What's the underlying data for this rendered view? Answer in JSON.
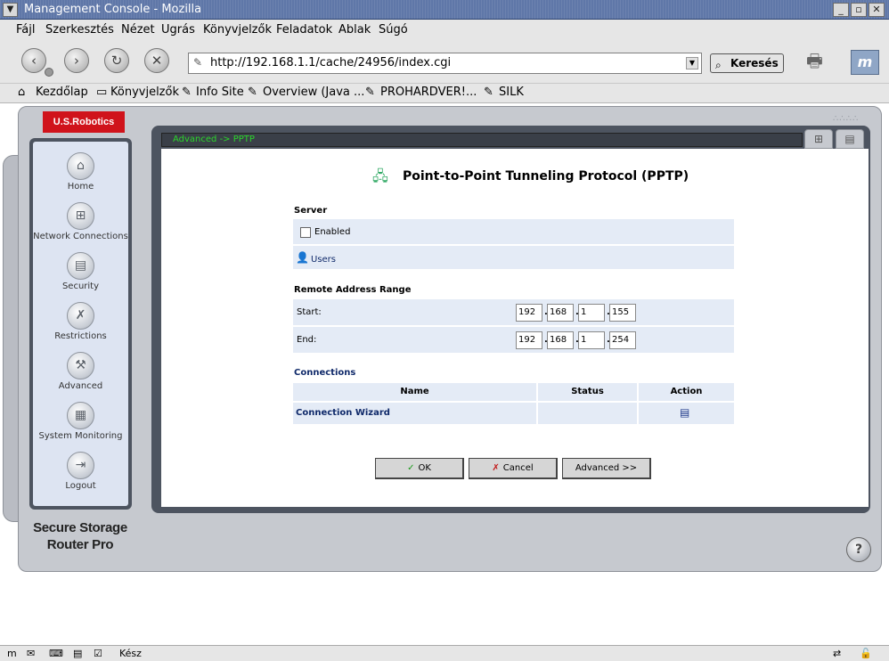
{
  "window": {
    "title": "Management Console - Mozilla"
  },
  "menu": [
    "Fájl",
    "Szerkesztés",
    "Nézet",
    "Ugrás",
    "Könyvjelzők",
    "Feladatok",
    "Ablak",
    "Súgó"
  ],
  "toolbar": {
    "url": "http://192.168.1.1/cache/24956/index.cgi",
    "search_label": "Keresés"
  },
  "bookmarks": [
    "Kezdőlap",
    "Könyvjelzők",
    "Info Site",
    "Overview (Java ...",
    "PROHARDVER!...",
    "SILK"
  ],
  "brand": {
    "logo": "U.S.Robotics",
    "product_line1": "Secure Storage",
    "product_line2": "Router Pro"
  },
  "sidebar": {
    "items": [
      "Home",
      "Network Connections",
      "Security",
      "Restrictions",
      "Advanced",
      "System Monitoring",
      "Logout"
    ]
  },
  "breadcrumb": "Advanced -> PPTP",
  "page": {
    "title": "Point-to-Point Tunneling Protocol (PPTP)"
  },
  "server": {
    "heading": "Server",
    "enabled_label": "Enabled",
    "enabled": false,
    "users_link": "Users"
  },
  "range": {
    "heading": "Remote Address Range",
    "start_label": "Start:",
    "start": [
      "192",
      "168",
      "1",
      "155"
    ],
    "end_label": "End:",
    "end": [
      "192",
      "168",
      "1",
      "254"
    ]
  },
  "connections": {
    "heading": "Connections",
    "columns": [
      "Name",
      "Status",
      "Action"
    ],
    "rows": [
      {
        "name": "Connection Wizard",
        "status": ""
      }
    ]
  },
  "buttons": {
    "ok": "OK",
    "cancel": "Cancel",
    "advanced": "Advanced >>"
  },
  "status": {
    "text": "Kész"
  },
  "colors": {
    "accent": "#d0131b",
    "nav_bg": "#dde4f2",
    "row_bg": "#e4ebf6",
    "crumb_text": "#2bd52b"
  }
}
